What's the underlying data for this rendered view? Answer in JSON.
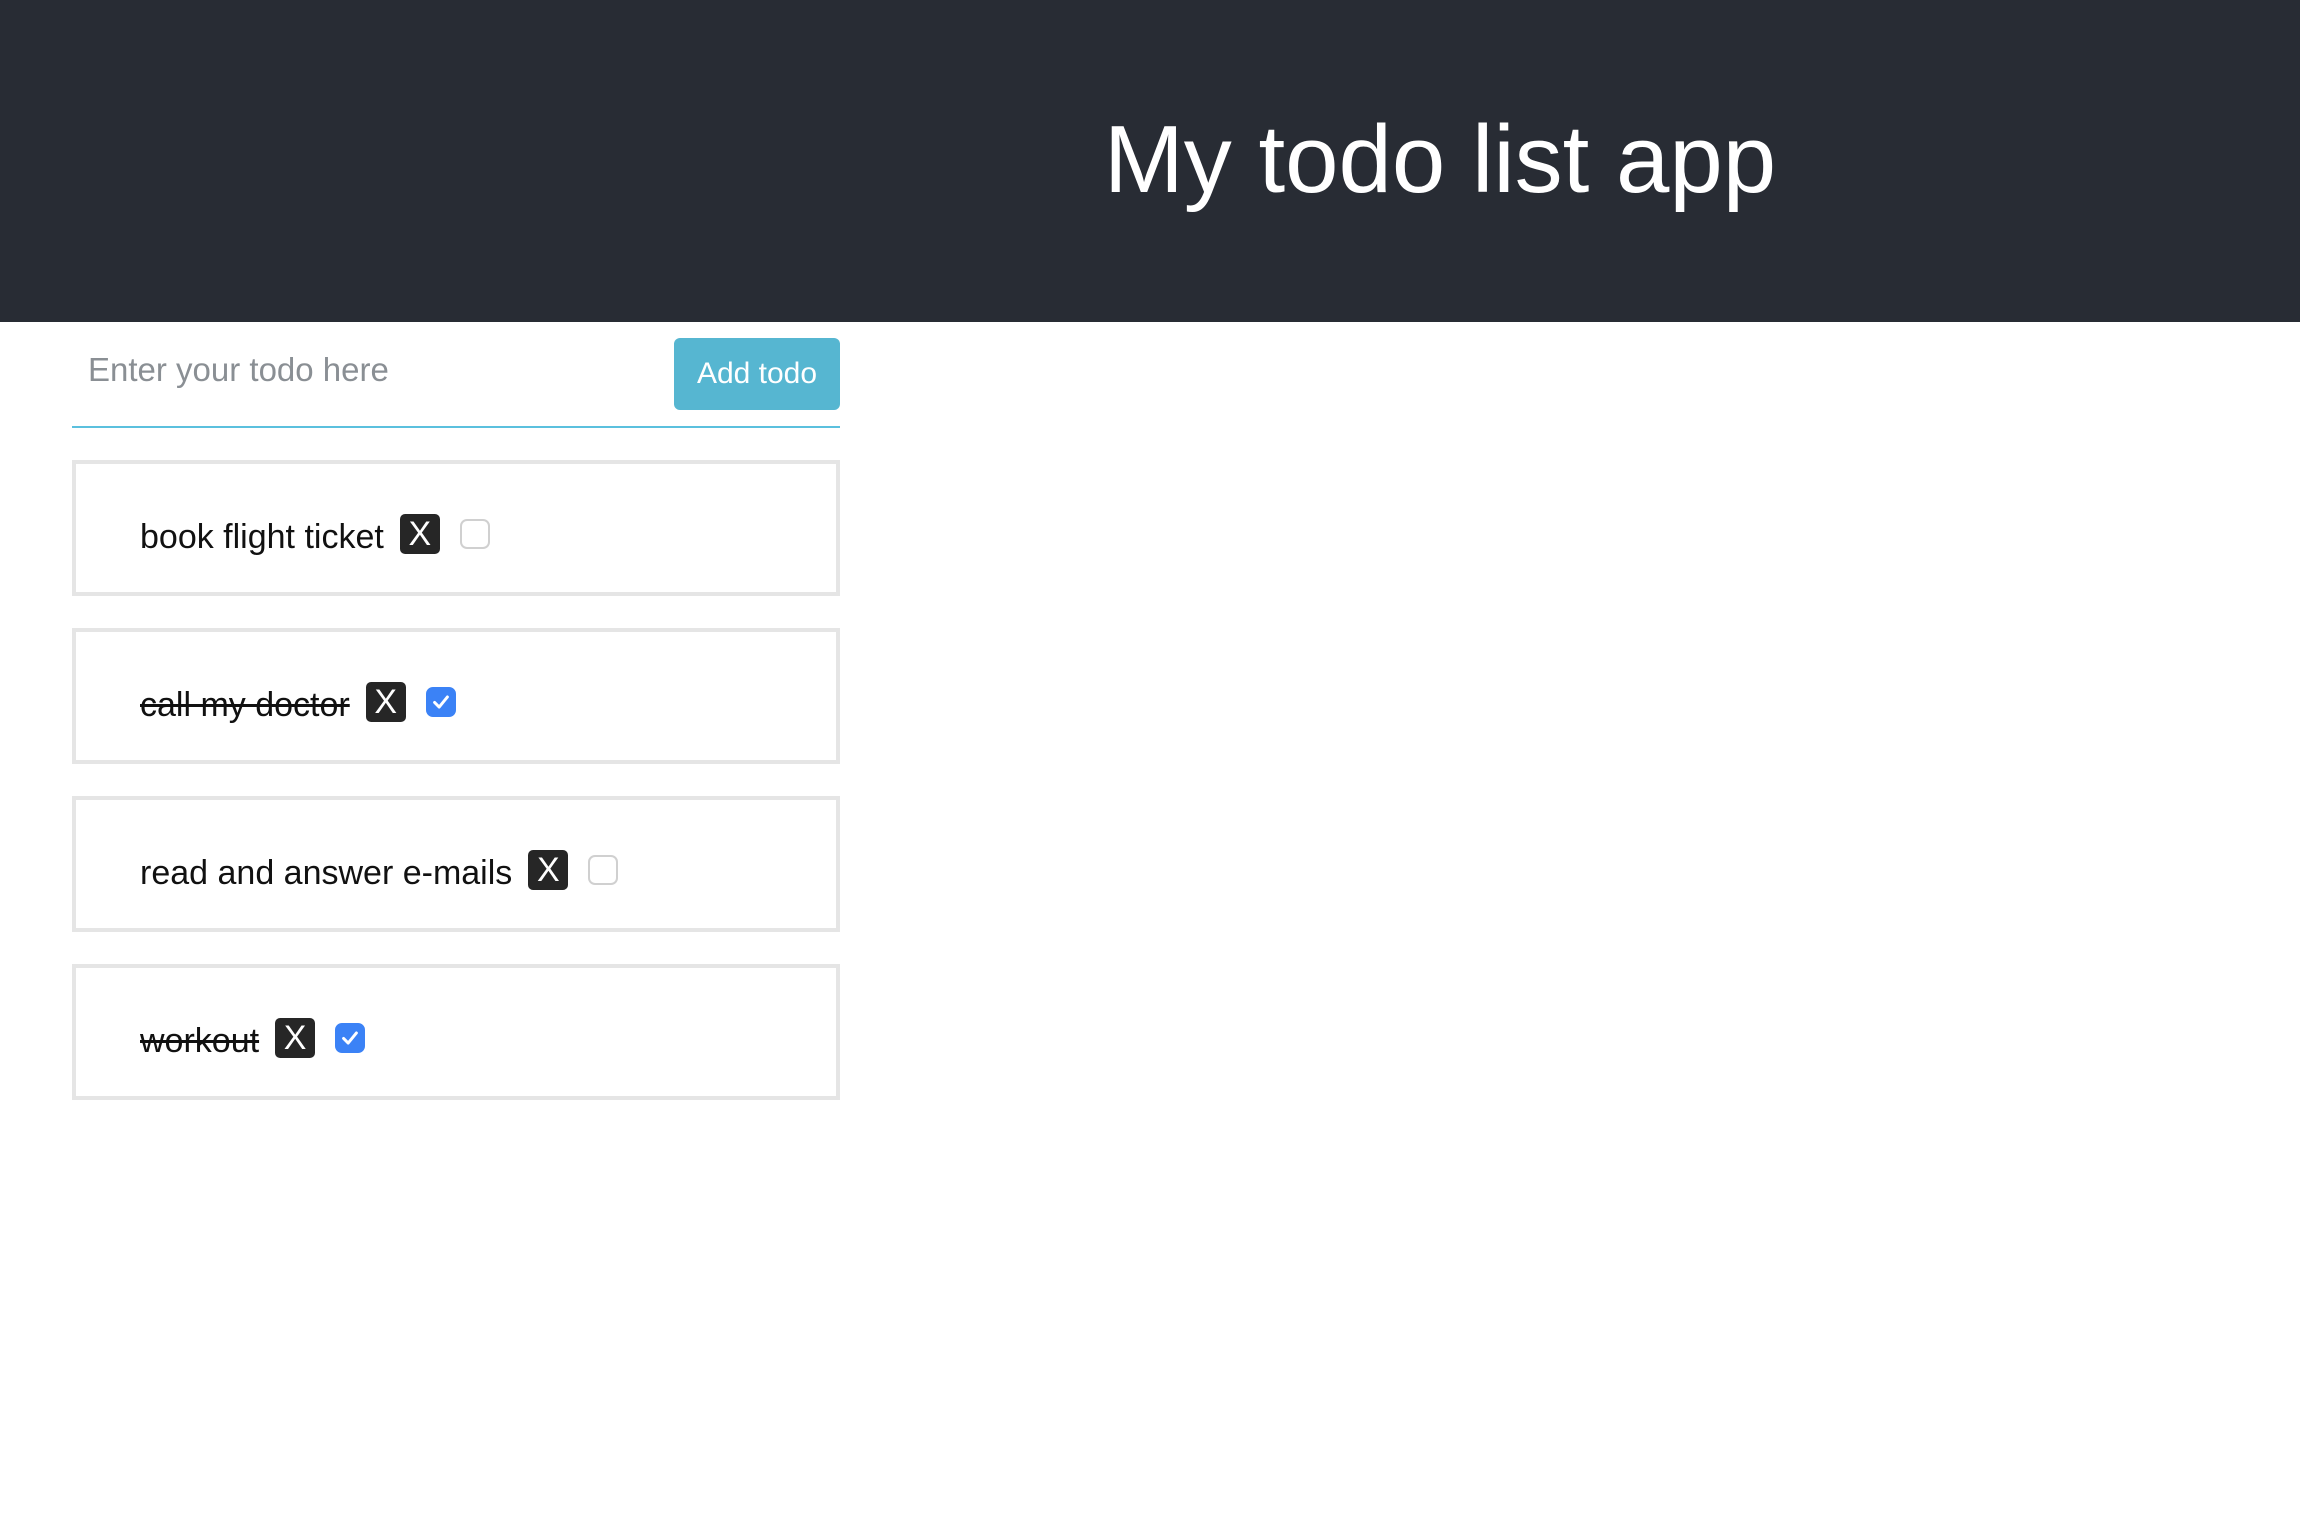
{
  "header": {
    "title": "My todo list app",
    "background": "#282c34"
  },
  "form": {
    "input_placeholder": "Enter your todo here",
    "input_value": "",
    "add_button_label": "Add todo",
    "accent_color": "#56b6d1"
  },
  "todos": [
    {
      "text": "book flight ticket",
      "done": false,
      "delete_label": "X",
      "checkbox_icon": "checkbox-unchecked-icon"
    },
    {
      "text": "call my doctor",
      "done": true,
      "delete_label": "X",
      "checkbox_icon": "checkbox-checked-icon"
    },
    {
      "text": "read and answer e-mails",
      "done": false,
      "delete_label": "X",
      "checkbox_icon": "checkbox-unchecked-icon"
    },
    {
      "text": "workout",
      "done": true,
      "delete_label": "X",
      "checkbox_icon": "checkbox-checked-icon"
    }
  ],
  "checkbox_checked_color": "#3b82f6"
}
